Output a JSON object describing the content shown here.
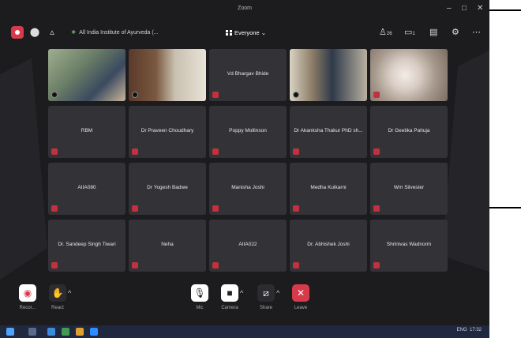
{
  "window": {
    "title": "Zoom",
    "minimize": "–",
    "maximize": "□",
    "close": "✕"
  },
  "toolbar": {
    "institution": "All India Institute of Ayurveda (...",
    "view_label": "Everyone",
    "participants_count": "26",
    "chat_count": "1"
  },
  "tiles": [
    {
      "name": "",
      "video": true,
      "mic": "on"
    },
    {
      "name": "",
      "video": true,
      "mic": "on"
    },
    {
      "name": "Vd Bhargav Bhide",
      "video": false,
      "mic": "off"
    },
    {
      "name": "",
      "video": true,
      "mic": "on"
    },
    {
      "name": "",
      "video": true,
      "mic": "off"
    },
    {
      "name": "RBM",
      "video": false,
      "mic": "off"
    },
    {
      "name": "Dr Praveen Choudhary",
      "video": false,
      "mic": "off"
    },
    {
      "name": "Poppy Mollinson",
      "video": false,
      "mic": "off"
    },
    {
      "name": "Dr Akanksha Thakur PhD sh...",
      "video": false,
      "mic": "off"
    },
    {
      "name": "Dr Geetika Pahuja",
      "video": false,
      "mic": "off"
    },
    {
      "name": "AIIA080",
      "video": false,
      "mic": "off"
    },
    {
      "name": "Dr Yogesh Badwe",
      "video": false,
      "mic": "off"
    },
    {
      "name": "Manisha Joshi",
      "video": false,
      "mic": "off"
    },
    {
      "name": "Medha Kulkarni",
      "video": false,
      "mic": "off"
    },
    {
      "name": "Wm Silvester",
      "video": false,
      "mic": "off"
    },
    {
      "name": "Dr. Sandeep Singh Tiwari",
      "video": false,
      "mic": "off"
    },
    {
      "name": "Neha",
      "video": false,
      "mic": "off"
    },
    {
      "name": "AIIA022",
      "video": false,
      "mic": "off"
    },
    {
      "name": "Dr. Abhishek Joshi",
      "video": false,
      "mic": "off"
    },
    {
      "name": "Shrinivas Wadnorm",
      "video": false,
      "mic": "off"
    }
  ],
  "controls": {
    "record": "Recor...",
    "react": "React",
    "mic": "Mic",
    "camera": "Camera",
    "share": "Share",
    "leave": "Leave"
  },
  "taskbar": {
    "lang": "ENG",
    "time": "17:32"
  },
  "colors": {
    "app_bg": "#1c1c1f",
    "tile_bg": "#333337",
    "accent_red": "#d63a4b",
    "taskbar": "#202840"
  }
}
